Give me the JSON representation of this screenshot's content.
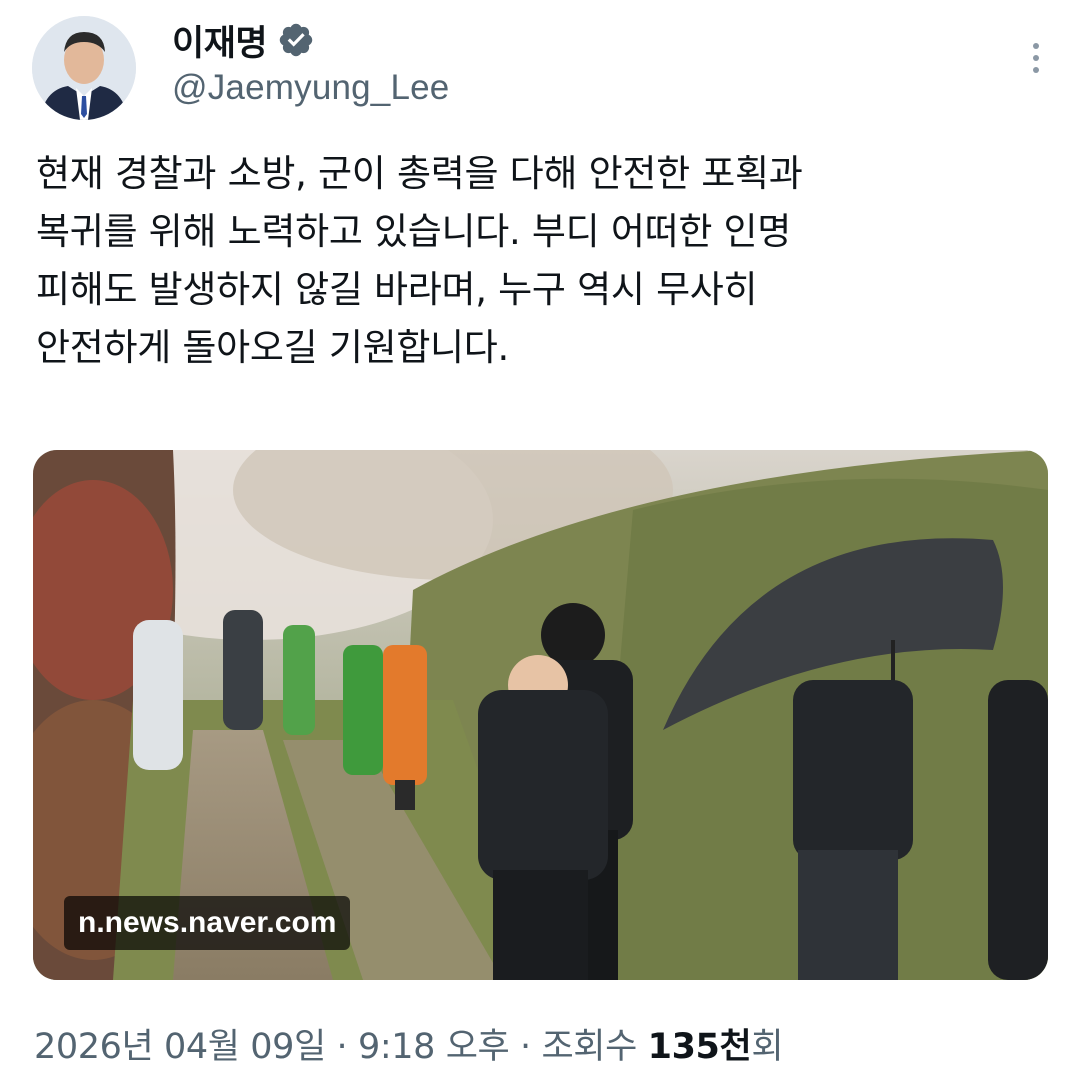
{
  "author": {
    "display_name": "이재명",
    "handle": "@Jaemyung_Lee",
    "verified": true,
    "avatar_icon": "profile-photo",
    "verified_icon": "verified-badge-icon",
    "verified_color": "#536471"
  },
  "menu": {
    "icon": "more-vertical-icon"
  },
  "tweet": {
    "lines": [
      "현재 경찰과 소방, 군이 총력을 다해 안전한 포획과",
      "복귀를 위해 노력하고 있습니다. 부디 어떠한 인명",
      "피해도 발생하지 않길 바라며, 누구 역시 무사히",
      "안전하게 돌아오길 기원합니다."
    ]
  },
  "media": {
    "source_label": "n.news.naver.com",
    "description_icon": "news-photo"
  },
  "meta": {
    "date": "2026년 04월 09일",
    "separator": " · ",
    "time": "9:18 오후",
    "views_label": "조회수 ",
    "views_number": "135천",
    "views_suffix": "회"
  },
  "colors": {
    "text": "#0f1419",
    "secondary": "#536471",
    "background": "#ffffff"
  }
}
